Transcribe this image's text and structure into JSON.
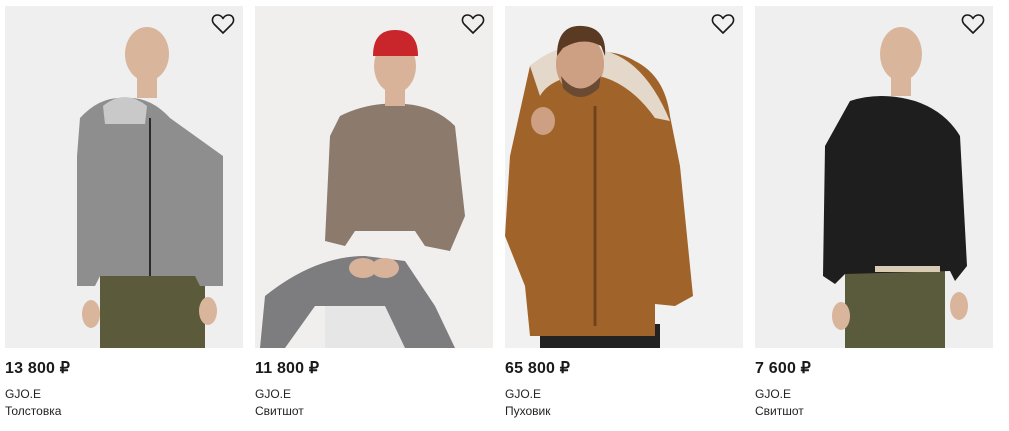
{
  "products": [
    {
      "price": "13 800 ₽",
      "brand": "GJO.E",
      "type": "Толстовка",
      "garment_color": "#8e8e8e"
    },
    {
      "price": "11 800 ₽",
      "brand": "GJO.E",
      "type": "Свитшот",
      "garment_color": "#8c7a6d"
    },
    {
      "price": "65 800 ₽",
      "brand": "GJO.E",
      "type": "Пуховик",
      "garment_color": "#a0642a"
    },
    {
      "price": "7 600 ₽",
      "brand": "GJO.E",
      "type": "Свитшот",
      "garment_color": "#1e1e1e"
    }
  ],
  "icons": {
    "favorite": "heart-outline-icon"
  }
}
